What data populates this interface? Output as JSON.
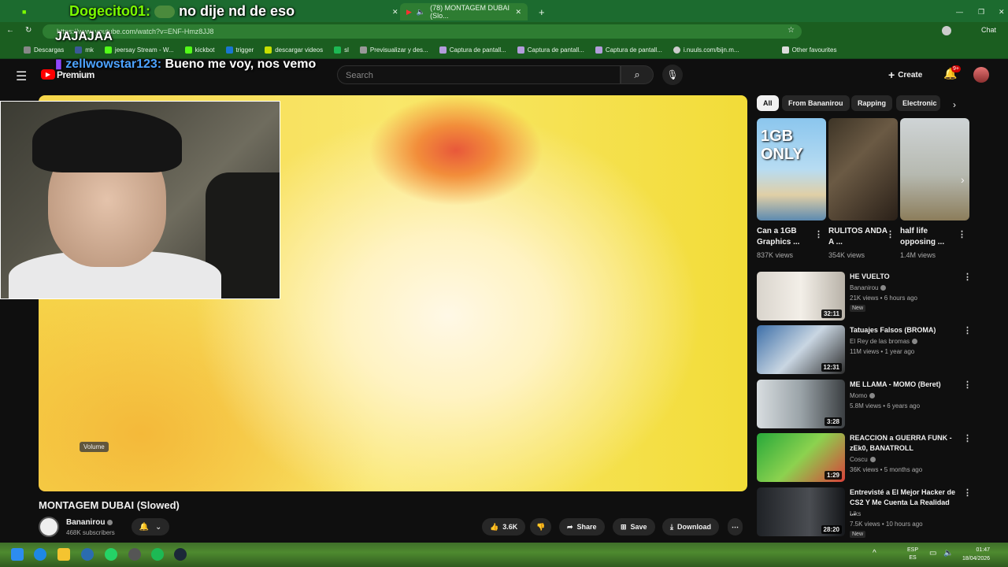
{
  "browser": {
    "tabs": [
      {
        "label": "",
        "active": false
      },
      {
        "label": "(78) MONTAGEM DUBAI (Slo...",
        "active": true
      }
    ],
    "new_tab_icon": "plus-icon",
    "url": "https://www.youtube.com/watch?v=ENF-Hmz8JJ8",
    "bookmarks": [
      "Descargas",
      "mk",
      "jeersay Stream - W...",
      "kickbot",
      "trigger",
      "descargar videos",
      "sl",
      "Previsualizar y des...",
      "Captura de pantall...",
      "Captura de pantall...",
      "Captura de pantall...",
      "i.nuuls.com/bijn.m..."
    ],
    "other_favourites": "Other favourites",
    "chat_button": "Chat"
  },
  "stream_chat": [
    {
      "user": "Dogecito01:",
      "message": "no dije nd de eso"
    },
    {
      "user": "",
      "message": "JAJAJAA"
    },
    {
      "user": "zellwowstar123:",
      "message": "Bueno me voy, nos vemo"
    }
  ],
  "youtube": {
    "logo_text": "Premium",
    "search_placeholder": "Search",
    "create_label": "Create",
    "notification_count": "9+"
  },
  "video": {
    "title": "MONTAGEM DUBAI (Slowed)",
    "volume_tooltip": "Volume",
    "channel": "Bananirou",
    "subscribers": "468K subscribers",
    "likes": "3.6K",
    "share": "Share",
    "save": "Save",
    "download": "Download"
  },
  "sidebar": {
    "chips": [
      "All",
      "From Bananirou",
      "Rapping",
      "Electronic"
    ],
    "shorts": [
      {
        "title": "Can a 1GB Graphics ...",
        "views": "837K views",
        "thumb_text": "1GB ONLY"
      },
      {
        "title": "RULITOS ANDA A ...",
        "views": "354K views",
        "thumb_text": ""
      },
      {
        "title": "half life opposing ...",
        "views": "1.4M views",
        "thumb_text": ""
      }
    ],
    "recommended": [
      {
        "title": "HE VUELTO",
        "channel": "Bananirou",
        "meta": "21K views • 6 hours ago",
        "duration": "32:11",
        "new": "New"
      },
      {
        "title": "Tatuajes Falsos (BROMA)",
        "channel": "El Rey de las bromas",
        "meta": "11M views • 1 year ago",
        "duration": "12:31",
        "new": ""
      },
      {
        "title": "ME LLAMA - MOMO (Beret)",
        "channel": "Momo",
        "meta": "5.8M views • 6 years ago",
        "duration": "3:28",
        "new": ""
      },
      {
        "title": "REACCION a GUERRA FUNK - zEk0, BANATROLL",
        "channel": "Coscu",
        "meta": "36K views • 5 months ago",
        "duration": "1:29",
        "new": ""
      },
      {
        "title": "Entrevisté a El Mejor Hacker de CS2 Y Me Cuenta La Realidad ...",
        "channel": "Liks",
        "meta": "7.5K views • 10 hours ago",
        "duration": "28:20",
        "new": "New"
      }
    ]
  },
  "taskbar": {
    "lang": "ESP",
    "lang_sub": "ES",
    "time": "01:47",
    "date": "18/04/2026"
  }
}
